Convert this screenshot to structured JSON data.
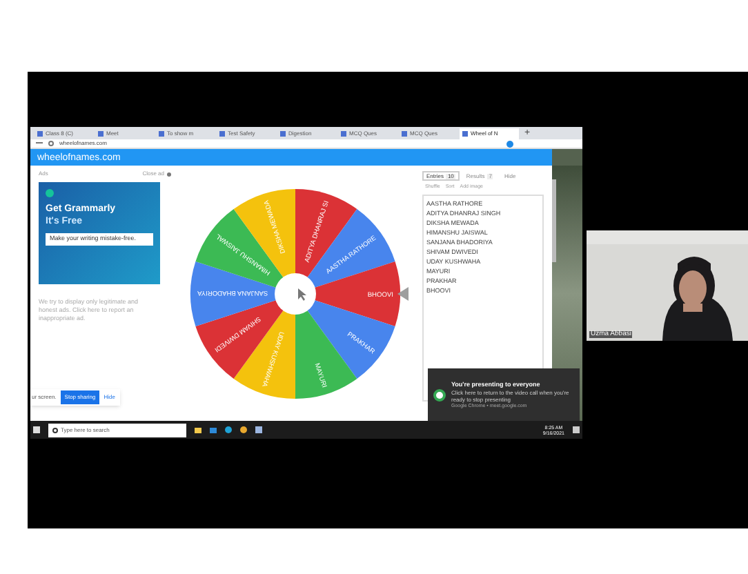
{
  "browser": {
    "tabs": [
      {
        "label": "Class 8 (C)",
        "selected": false
      },
      {
        "label": "Meet",
        "selected": false
      },
      {
        "label": "To show m",
        "selected": false
      },
      {
        "label": "Test Safety",
        "selected": false
      },
      {
        "label": "Digestion",
        "selected": false
      },
      {
        "label": "MCQ Ques",
        "selected": false
      },
      {
        "label": "MCQ Ques",
        "selected": false
      },
      {
        "label": "Wheel of N",
        "selected": true
      }
    ],
    "new_tab": "+",
    "url": "wheelofnames.com"
  },
  "site": {
    "title": "wheelofnames.com"
  },
  "ads": {
    "label": "Ads",
    "close": "Close ad",
    "headline": "Get Grammarly",
    "subline": "It's Free",
    "cta": "Make your writing mistake-free.",
    "note": "We try to display only legitimate and honest ads. Click here to report an inappropriate ad."
  },
  "wheel": {
    "segments": [
      {
        "label": "ADITYA DHANRAJ SI",
        "color": "#db3236"
      },
      {
        "label": "AASTHA RATHORE",
        "color": "#4885ed"
      },
      {
        "label": "BHOOVI",
        "color": "#db3236"
      },
      {
        "label": "PRAKHAR",
        "color": "#4885ed"
      },
      {
        "label": "MAYURI",
        "color": "#3cba54"
      },
      {
        "label": "UDAY KUSHWAHA",
        "color": "#f4c20d"
      },
      {
        "label": "SHIVAM DWIVEDI",
        "color": "#db3236"
      },
      {
        "label": "SANJANA BHADORIYA",
        "color": "#4885ed"
      },
      {
        "label": "HIMANSHU JAISWAL",
        "color": "#3cba54"
      },
      {
        "label": "DIKSHA MEWADA",
        "color": "#f4c20d"
      }
    ]
  },
  "panel": {
    "tabs": [
      {
        "label": "Entries",
        "count": "10",
        "selected": true
      },
      {
        "label": "Results",
        "count": "7",
        "selected": false
      },
      {
        "label": "Hide",
        "selected": false
      }
    ],
    "tools": [
      "Shuffle",
      "Sort",
      "Add image"
    ],
    "entries": [
      "AASTHA RATHORE",
      "ADITYA DHANRAJ SINGH",
      "DIKSHA MEWADA",
      "HIMANSHU JAISWAL",
      "SANJANA BHADORIYA",
      "SHIVAM DWIVEDI",
      "UDAY KUSHWAHA",
      "MAYURI",
      "PRAKHAR",
      "BHOOVI"
    ]
  },
  "share_bar": {
    "text": "ur screen.",
    "stop": "Stop sharing",
    "hide": "Hide"
  },
  "notification": {
    "title": "You're presenting to everyone",
    "body": "Click here to return to the video call when you're ready to stop presenting",
    "source": "Google Chrome • meet.google.com"
  },
  "taskbar": {
    "placeholder": "Type here to search",
    "time": "8:25 AM",
    "date": "9/16/2021"
  },
  "participant": {
    "name": "Uzma Abbasi"
  }
}
